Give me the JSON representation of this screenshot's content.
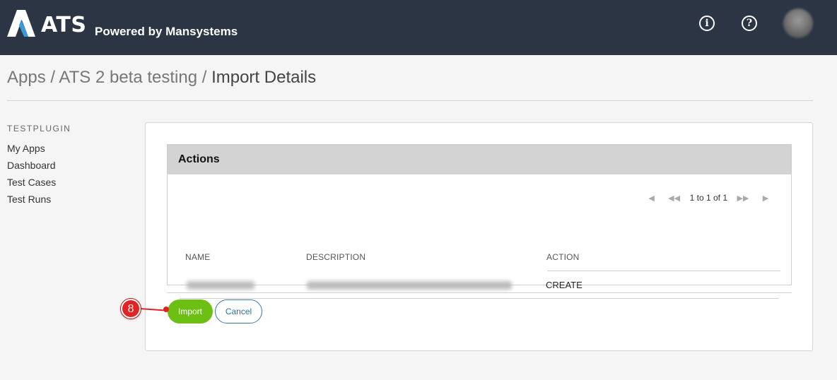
{
  "header": {
    "logo_text": "ATS",
    "powered_by": "Powered by Mansystems",
    "icons": [
      "info-icon",
      "help-icon"
    ],
    "colors": {
      "bar": "#2b3544",
      "logo_accent": "#3a9bd9"
    }
  },
  "breadcrumb": {
    "items": [
      "Apps",
      "ATS 2 beta testing",
      "Import Details"
    ],
    "separator": "/"
  },
  "sidebar": {
    "title": "TESTPLUGIN",
    "items": [
      {
        "label": "My Apps"
      },
      {
        "label": "Dashboard"
      },
      {
        "label": "Test Cases"
      },
      {
        "label": "Test Runs"
      }
    ]
  },
  "panel": {
    "title": "Actions",
    "pager": {
      "text": "1 to 1 of 1",
      "first": "first-page-icon",
      "prev": "previous-page-icon",
      "next": "next-page-icon",
      "last": "last-page-icon"
    },
    "columns": [
      "NAME",
      "DESCRIPTION",
      "ACTION"
    ],
    "rows": [
      {
        "name": "",
        "description": "",
        "action": "CREATE"
      }
    ]
  },
  "buttons": {
    "import": "Import",
    "cancel": "Cancel",
    "colors": {
      "import_bg": "#6cbf13",
      "cancel_border": "#3a78a8"
    }
  },
  "annotation": {
    "step": "8",
    "color": "#e02424"
  }
}
